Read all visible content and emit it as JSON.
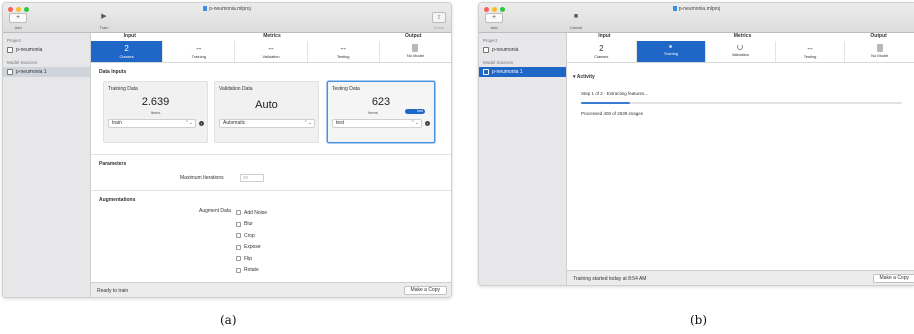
{
  "panel_a": {
    "window_title": "p-neumonia.mlproj",
    "toolbar": {
      "add_label": "Add",
      "run_label": "Train",
      "share_label": "Share"
    },
    "sidebar": {
      "project_heading": "Project",
      "project_name": "p-neumonia",
      "sources_heading": "Model Sources",
      "source_name": "p-neumonia 1"
    },
    "stages": {
      "input": "Input",
      "metrics": "Metrics",
      "output": "Output"
    },
    "tabs": [
      {
        "value": "2",
        "label": "Classes"
      },
      {
        "value": "--",
        "label": "Training"
      },
      {
        "value": "--",
        "label": "Validation"
      },
      {
        "value": "--",
        "label": "Testing"
      },
      {
        "value": "",
        "label": "No Model"
      }
    ],
    "data_inputs": {
      "heading": "Data Inputs",
      "training": {
        "title": "Training Data",
        "value": "2.639",
        "unit": "Items",
        "source": "train"
      },
      "validation": {
        "title": "Validation Data",
        "value": "Auto",
        "source": "Automatic"
      },
      "testing": {
        "title": "Testing Data",
        "value": "623",
        "unit": "Items",
        "toggle": "test",
        "source": "test"
      }
    },
    "parameters": {
      "heading": "Parameters",
      "max_iterations_label": "Maximum Iterations",
      "max_iterations_placeholder": "25"
    },
    "augmentations": {
      "heading": "Augmentations",
      "label": "Augment Data",
      "options": [
        "Add Noise",
        "Blur",
        "Crop",
        "Expose",
        "Flip",
        "Rotate"
      ]
    },
    "status": {
      "text": "Ready to train",
      "copy_label": "Make a Copy"
    }
  },
  "panel_b": {
    "window_title": "p-neumonia.mlproj",
    "toolbar": {
      "add_label": "Add",
      "run_label": "Cancel"
    },
    "sidebar": {
      "project_heading": "Project",
      "project_name": "p-neumonia",
      "sources_heading": "Model Sources",
      "source_name": "p-neumonia 1"
    },
    "stages": {
      "input": "Input",
      "metrics": "Metrics",
      "output": "Output"
    },
    "tabs": [
      {
        "value": "2",
        "label": "Classes"
      },
      {
        "value": "",
        "label": "Training"
      },
      {
        "value": "",
        "label": "Validation"
      },
      {
        "value": "--",
        "label": "Testing"
      },
      {
        "value": "",
        "label": "No Model"
      }
    ],
    "activity": {
      "heading": "Activity",
      "step": "Step 1 of 2 - Extracting features...",
      "processed": "Processed 400 of 2639 images",
      "progress_fraction": 0.154
    },
    "status": {
      "text": "Training started today at 8:54 AM",
      "copy_label": "Make a Copy"
    }
  },
  "captions": {
    "a": "(a)",
    "b": "(b)"
  },
  "colors": {
    "accent": "#1f67c7",
    "focus": "#4a90e2",
    "progress": "#3a7bd5"
  },
  "icons": [
    "plus-icon",
    "play-icon",
    "stop-icon",
    "share-icon",
    "document-icon",
    "model-source-icon",
    "checkbox-icon",
    "chevron-icon",
    "arrow-circle-icon",
    "spinner-icon"
  ]
}
